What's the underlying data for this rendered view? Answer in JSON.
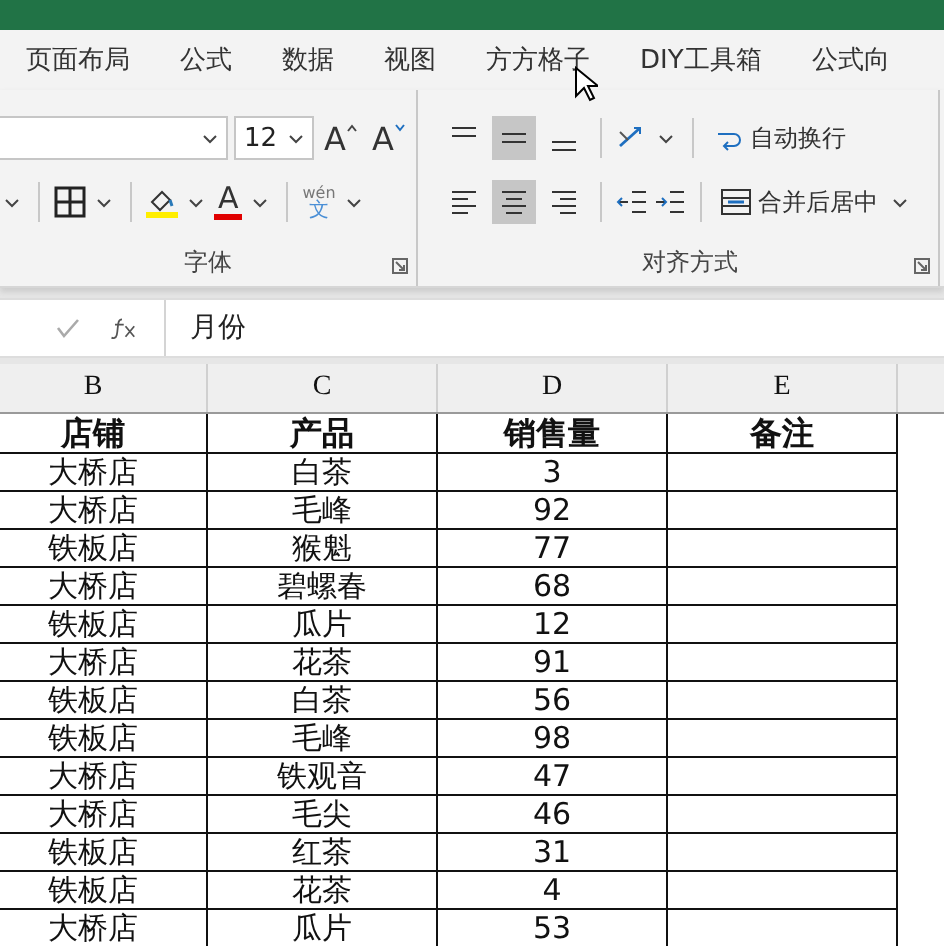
{
  "tabs": [
    {
      "label": "页面布局",
      "selected": false
    },
    {
      "label": "公式",
      "selected": false
    },
    {
      "label": "数据",
      "selected": false
    },
    {
      "label": "视图",
      "selected": false
    },
    {
      "label": "方方格子",
      "selected": false
    },
    {
      "label": "DIY工具箱",
      "selected": false
    },
    {
      "label": "公式向",
      "selected": false
    }
  ],
  "font_group": {
    "label": "字体",
    "font_size": "12",
    "grow_glyph": "A",
    "shrink_glyph": "A",
    "font_color_glyph": "A",
    "phonetic_top": "wén",
    "phonetic_bottom": "文"
  },
  "align_group": {
    "label": "对齐方式",
    "vertical": [
      {
        "kind": "top",
        "selected": false
      },
      {
        "kind": "middle",
        "selected": true
      },
      {
        "kind": "bottom",
        "selected": false
      }
    ],
    "horizontal": [
      {
        "kind": "left",
        "selected": false
      },
      {
        "kind": "center",
        "selected": true
      },
      {
        "kind": "right",
        "selected": false
      }
    ],
    "wrap_text": "自动换行",
    "merge_center": "合并后居中"
  },
  "formula_bar": {
    "value": "月份"
  },
  "columns": [
    "B",
    "C",
    "D",
    "E"
  ],
  "header": [
    "店铺",
    "产品",
    "销售量",
    "备注"
  ],
  "rows": [
    [
      "大桥店",
      "白茶",
      "3"
    ],
    [
      "大桥店",
      "毛峰",
      "92"
    ],
    [
      "铁板店",
      "猴魁",
      "77"
    ],
    [
      "大桥店",
      "碧螺春",
      "68"
    ],
    [
      "铁板店",
      "瓜片",
      "12"
    ],
    [
      "大桥店",
      "花茶",
      "91"
    ],
    [
      "铁板店",
      "白茶",
      "56"
    ],
    [
      "铁板店",
      "毛峰",
      "98"
    ],
    [
      "大桥店",
      "铁观音",
      "47"
    ],
    [
      "大桥店",
      "毛尖",
      "46"
    ],
    [
      "铁板店",
      "红茶",
      "31"
    ],
    [
      "铁板店",
      "花茶",
      "4"
    ],
    [
      "大桥店",
      "瓜片",
      "53"
    ]
  ]
}
